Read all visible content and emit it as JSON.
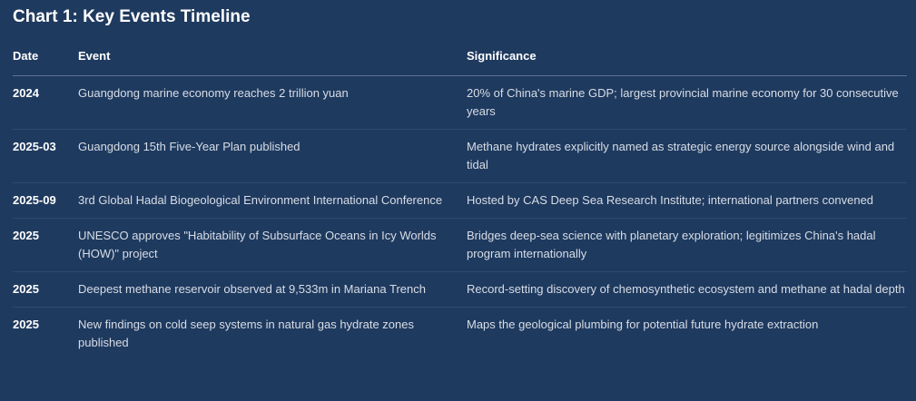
{
  "title": "Chart 1: Key Events Timeline",
  "columns": {
    "date": "Date",
    "event": "Event",
    "significance": "Significance"
  },
  "rows": [
    {
      "date": "2024",
      "event": "Guangdong marine economy reaches 2 trillion yuan",
      "significance": "20% of China's marine GDP; largest provincial marine economy for 30 consecutive years"
    },
    {
      "date": "2025-03",
      "event": "Guangdong 15th Five-Year Plan published",
      "significance": "Methane hydrates explicitly named as strategic energy source alongside wind and tidal"
    },
    {
      "date": "2025-09",
      "event": "3rd Global Hadal Biogeological Environment International Conference",
      "significance": "Hosted by CAS Deep Sea Research Institute; international partners convened"
    },
    {
      "date": "2025",
      "event": "UNESCO approves \"Habitability of Subsurface Oceans in Icy Worlds (HOW)\" project",
      "significance": "Bridges deep-sea science with planetary exploration; legitimizes China's hadal program internationally"
    },
    {
      "date": "2025",
      "event": "Deepest methane reservoir observed at 9,533m in Mariana Trench",
      "significance": "Record-setting discovery of chemosynthetic ecosystem and methane at hadal depth"
    },
    {
      "date": "2025",
      "event": "New findings on cold seep systems in natural gas hydrate zones published",
      "significance": "Maps the geological plumbing for potential future hydrate extraction"
    }
  ]
}
